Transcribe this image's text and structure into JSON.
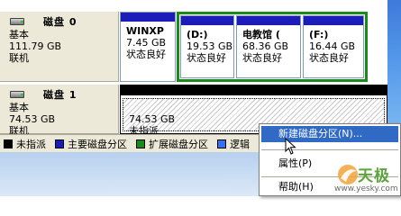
{
  "disks": [
    {
      "title": "磁盘 0",
      "type": "基本",
      "size": "111.79 GB",
      "state": "联机",
      "partitions": [
        {
          "name": "WINXP",
          "size": "7.45 GB",
          "status": "状态良好"
        },
        {
          "name": "(D:)",
          "size": "19.53 GB",
          "status": "状态良好"
        },
        {
          "name": "电教馆  (",
          "size": "68.36 GB",
          "status": "状态良好"
        },
        {
          "name": "(F:)",
          "size": "16.44 GB",
          "status": "状态良好"
        }
      ]
    },
    {
      "title": "磁盘 1",
      "type": "基本",
      "size": "74.53 GB",
      "state": "联机",
      "partitions": [
        {
          "size": "74.53 GB",
          "status": "未指派"
        }
      ]
    }
  ],
  "legend": [
    {
      "label": "未指派",
      "color": "#000000"
    },
    {
      "label": "主要磁盘分区",
      "color": "#1c1cb8"
    },
    {
      "label": "扩展磁盘分区",
      "color": "#1a8a1a"
    },
    {
      "label": "逻辑",
      "color": "#3a6ef0"
    }
  ],
  "context_menu": {
    "items": [
      {
        "label": "新建磁盘分区(N)...",
        "highlighted": true
      },
      {
        "label": "属性(P)",
        "highlighted": false
      },
      {
        "label": "帮助(H)",
        "highlighted": false
      }
    ]
  },
  "watermark": {
    "text": "天极",
    "url": "www.yesky.com"
  }
}
